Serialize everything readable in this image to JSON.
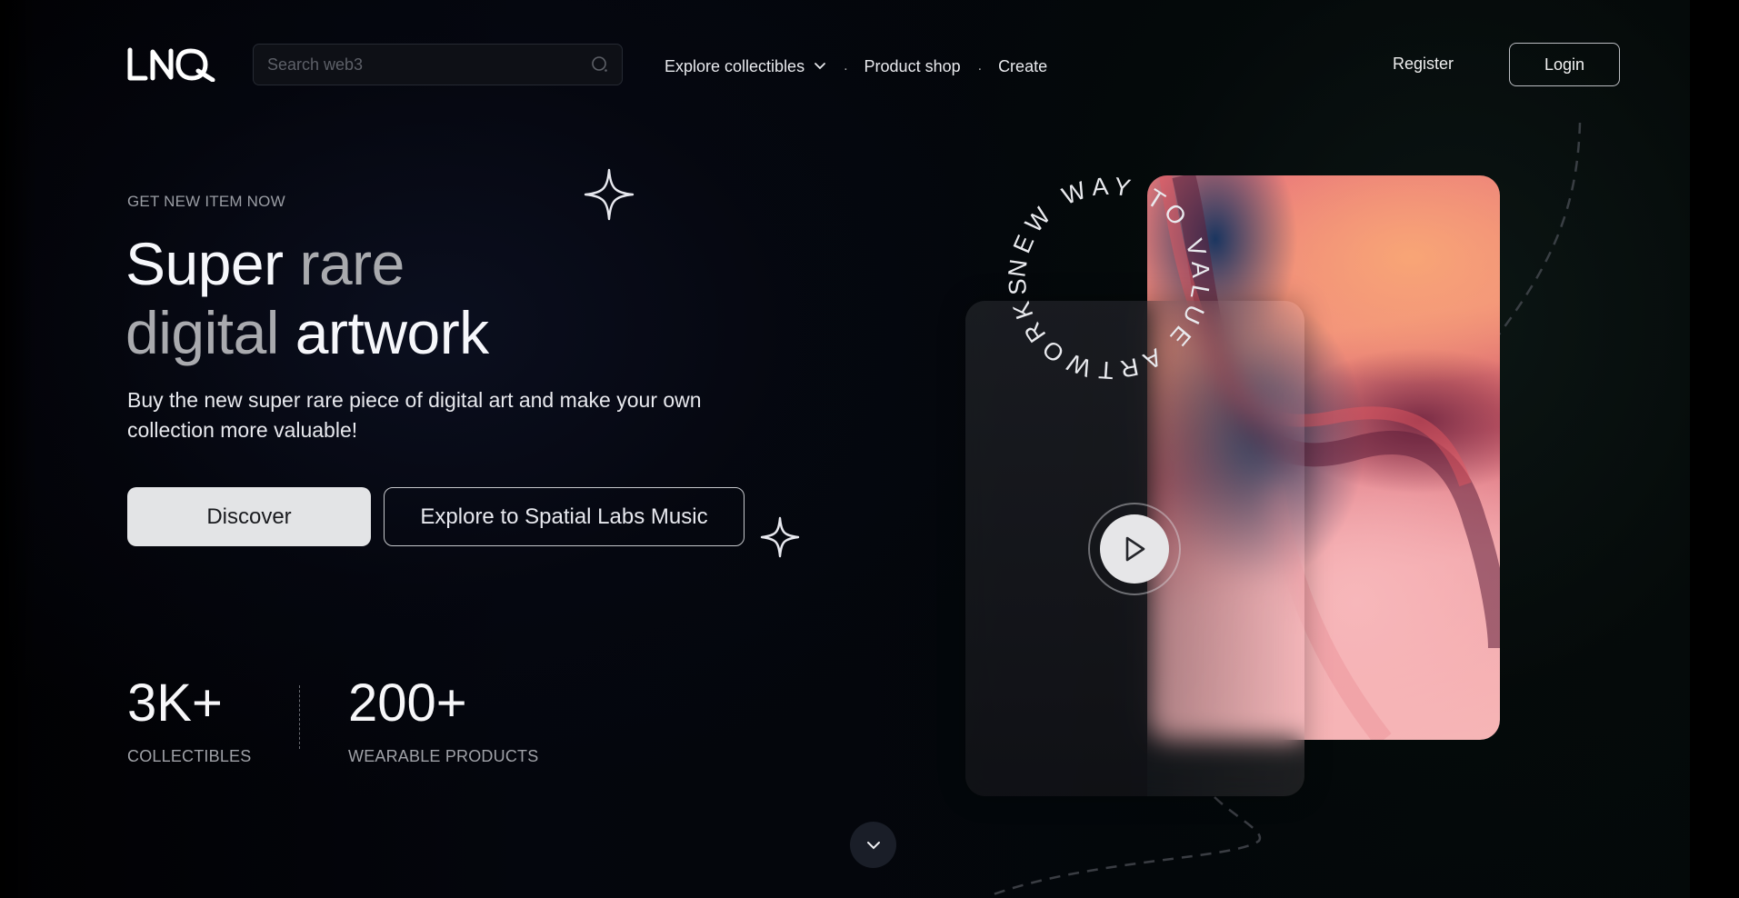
{
  "brand": {
    "logo_text": "LNQ"
  },
  "search": {
    "placeholder": "Search web3",
    "value": "",
    "icon": "search-icon"
  },
  "nav": {
    "items": [
      {
        "label": "Explore collectibles",
        "icon": "chevron-down-icon"
      },
      {
        "label": "Product shop"
      },
      {
        "label": "Create"
      }
    ],
    "separator": "."
  },
  "auth": {
    "register_label": "Register",
    "login_label": "Login"
  },
  "hero": {
    "eyebrow": "GET NEW ITEM NOW",
    "headline": {
      "line1_bright": "Super",
      "line1_muted": "rare",
      "line2_muted": "digital",
      "line2_bright": "artwork"
    },
    "subtitle": "Buy the new super rare piece of digital art and make your own collection more valuable!",
    "primary_button": "Discover",
    "secondary_button": "Explore to Spatial Labs Music"
  },
  "stats": [
    {
      "value": "3K+",
      "label": "COLLECTIBLES"
    },
    {
      "value": "200+",
      "label": "WEARABLE PRODUCTS"
    }
  ],
  "artwork": {
    "circular_text": "NEW WAY TO VALUE ARTWORKS.",
    "play_icon": "play-icon"
  },
  "scroll": {
    "icon": "chevron-down-icon"
  },
  "colors": {
    "background": "#04060d",
    "text_primary": "#f6f7fb",
    "text_muted": "#a9aaae",
    "button_light": "#e3e4e6",
    "art_peach": "#f8a576",
    "art_pink": "#f7b7ba",
    "art_navy": "#213a5e"
  }
}
